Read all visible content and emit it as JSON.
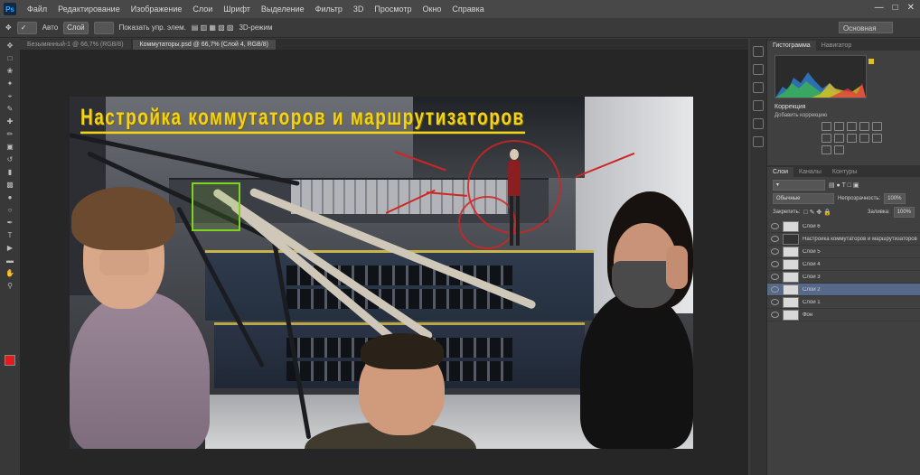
{
  "app": {
    "logo": "Ps",
    "menu": [
      "Файл",
      "Редактирование",
      "Изображение",
      "Слои",
      "Шрифт",
      "Выделение",
      "Фильтр",
      "3D",
      "Просмотр",
      "Окно",
      "Справка"
    ],
    "workspace": "Основная"
  },
  "options_bar": {
    "items": [
      "Авто",
      "Слой",
      "Показать упр. элем.",
      "3D-режим"
    ]
  },
  "document_tabs": [
    "Безымянный-1 @ 66,7% (RGB/8)",
    "Коммутаторы.psd @ 66,7% (Слой 4, RGB/8)"
  ],
  "canvas": {
    "title_overlay": "Настройка коммутаторов и маршрутизаторов"
  },
  "panels": {
    "top_tabs": [
      "Гистограмма",
      "Навигатор"
    ],
    "adjustments_title": "Коррекция",
    "adjustments_subtitle": "Добавить коррекцию",
    "layers_tabs": [
      "Слои",
      "Каналы",
      "Контуры"
    ],
    "blend_mode": "Обычные",
    "opacity_label": "Непрозрачность:",
    "opacity_value": "100%",
    "lock_label": "Закрепить:",
    "fill_label": "Заливка:",
    "fill_value": "100%",
    "layers": [
      {
        "name": "Слой 6",
        "selected": false
      },
      {
        "name": "Настройка коммутаторов и маршрутизаторов",
        "selected": false
      },
      {
        "name": "Слой 5",
        "selected": false
      },
      {
        "name": "Слой 4",
        "selected": false
      },
      {
        "name": "Слой 3",
        "selected": false
      },
      {
        "name": "Слой 2",
        "selected": true
      },
      {
        "name": "Слой 1",
        "selected": false
      },
      {
        "name": "Фон",
        "selected": false
      }
    ]
  },
  "colors": {
    "foreground": "#e21b1b",
    "background": "#ffffff",
    "title_yellow": "#f2d21a",
    "selection": "#57698a"
  }
}
